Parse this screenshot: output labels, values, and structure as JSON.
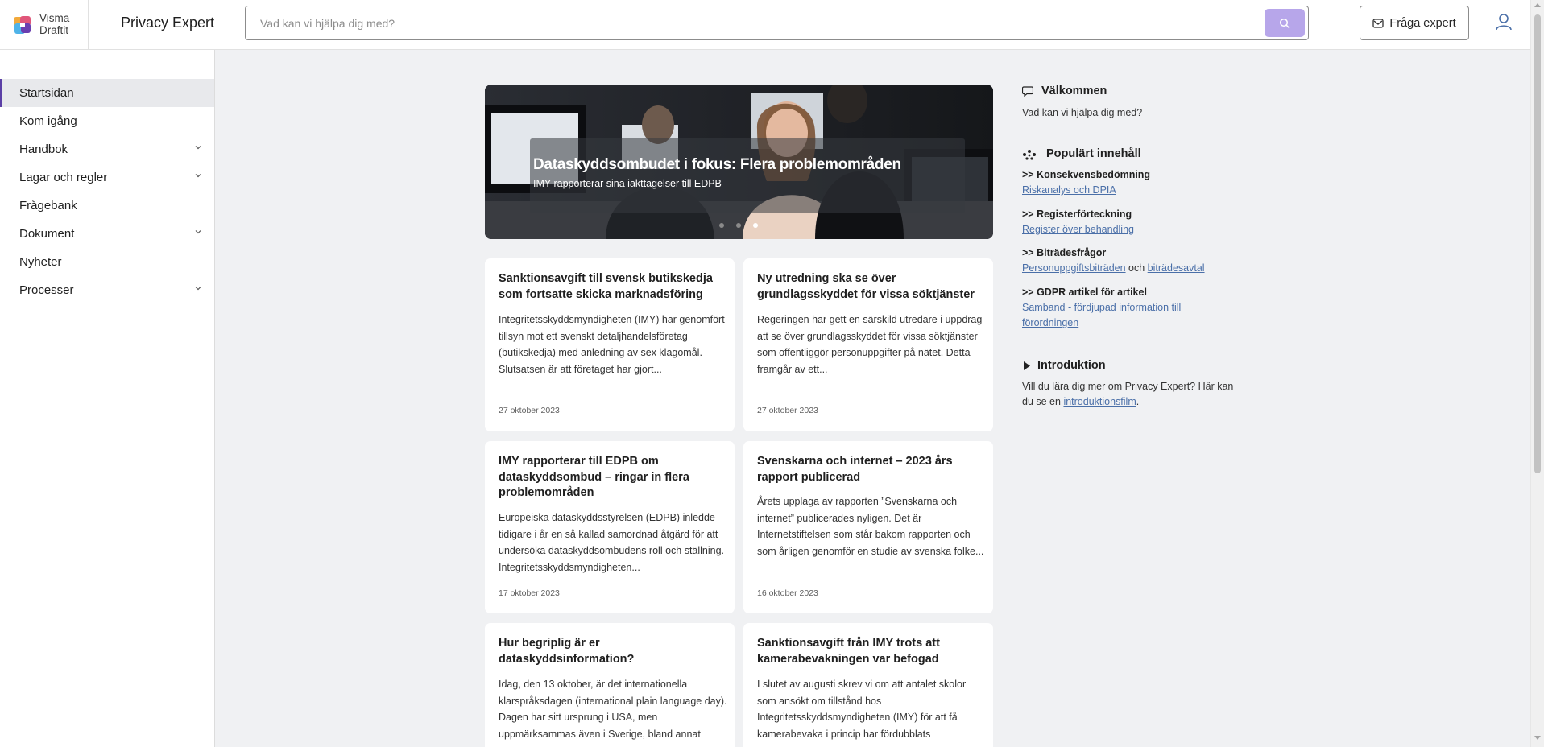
{
  "header": {
    "logo_line1": "Visma",
    "logo_line2": "Draftit",
    "app_title": "Privacy Expert",
    "search_placeholder": "Vad kan vi hjälpa dig med?",
    "ask_expert_label": "Fråga expert",
    "accent_color": "#b7a6ea"
  },
  "sidebar": {
    "items": [
      {
        "label": "Startsidan",
        "expandable": false,
        "active": true
      },
      {
        "label": "Kom igång",
        "expandable": false
      },
      {
        "label": "Handbok",
        "expandable": true
      },
      {
        "label": "Lagar och regler",
        "expandable": true
      },
      {
        "label": "Frågebank",
        "expandable": false
      },
      {
        "label": "Dokument",
        "expandable": true
      },
      {
        "label": "Nyheter",
        "expandable": false
      },
      {
        "label": "Processer",
        "expandable": true
      }
    ]
  },
  "hero": {
    "title": "Dataskyddsombudet i fokus: Flera problemområden",
    "subtitle": "IMY rapporterar sina iakttagelser till EDPB",
    "slide_count": 3,
    "active_slide": 3
  },
  "cards": [
    {
      "title": "Sanktionsavgift till svensk butikskedja som fortsatte skicka marknadsföring",
      "body": "Integritetsskyddsmyndigheten (IMY) har genomfört tillsyn mot ett svenskt detaljhandelsföretag (butikskedja) med anledning av sex klagomål. Slutsatsen är att företaget har gjort...",
      "date": "27 oktober 2023"
    },
    {
      "title": "Ny utredning ska se över grundlagsskyddet för vissa söktjänster",
      "body": "Regeringen har gett en särskild utredare i uppdrag att se över grundlagsskyddet för vissa söktjänster som offentliggör personuppgifter på nätet. Detta framgår av ett...",
      "date": "27 oktober 2023"
    },
    {
      "title": "IMY rapporterar till EDPB om dataskyddsombud – ringar in flera problemområden",
      "body": "Europeiska dataskyddsstyrelsen (EDPB) inledde tidigare i år en så kallad samordnad åtgärd för att undersöka dataskyddsombudens roll och ställning. Integritetsskyddsmyndigheten...",
      "date": "17 oktober 2023"
    },
    {
      "title": "Svenskarna och internet – 2023 års rapport publicerad",
      "body": "Årets upplaga av rapporten ”Svenskarna och internet” publicerades nyligen. Det är Internetstiftelsen som står bakom rapporten och som årligen genomför en studie av svenska folke...",
      "date": "16 oktober 2023"
    },
    {
      "title": "Hur begriplig är er dataskyddsinformation?",
      "body": "Idag, den 13 oktober, är det internationella klarspråksdagen (international plain language day). Dagen har sitt ursprung i USA, men uppmärksammas även i Sverige, bland annat",
      "date": ""
    },
    {
      "title": "Sanktionsavgift från IMY trots att kamerabevakningen var befogad",
      "body": "I slutet av augusti skrev vi om att antalet skolor som ansökt om tillstånd hos Integritetsskyddsmyndigheten (IMY) för att få kamerabevaka i princip har fördubblats",
      "date": ""
    }
  ],
  "right": {
    "welcome_title": "Välkommen",
    "welcome_text": "Vad kan vi hjälpa dig med?",
    "popular_title": "Populärt innehåll",
    "popular": [
      {
        "heading": ">> Konsekvensbedömning",
        "links": [
          "Riskanalys och DPIA"
        ],
        "joiner": ""
      },
      {
        "heading": ">> Registerförteckning",
        "links": [
          "Register över behandling"
        ],
        "joiner": ""
      },
      {
        "heading": ">> Biträdesfrågor",
        "links": [
          "Personuppgiftsbiträden",
          "biträdesavtal"
        ],
        "joiner": " och "
      },
      {
        "heading": ">> GDPR artikel för artikel",
        "links": [
          "Samband - fördjupad information till",
          "förordningen"
        ],
        "joiner": ""
      }
    ],
    "intro_title": "Introduktion",
    "intro_text1": "Vill du lära dig mer om Privacy Expert? Här kan",
    "intro_text2": "du se en ",
    "intro_link": "introduktionsfilm",
    "intro_end": "."
  }
}
